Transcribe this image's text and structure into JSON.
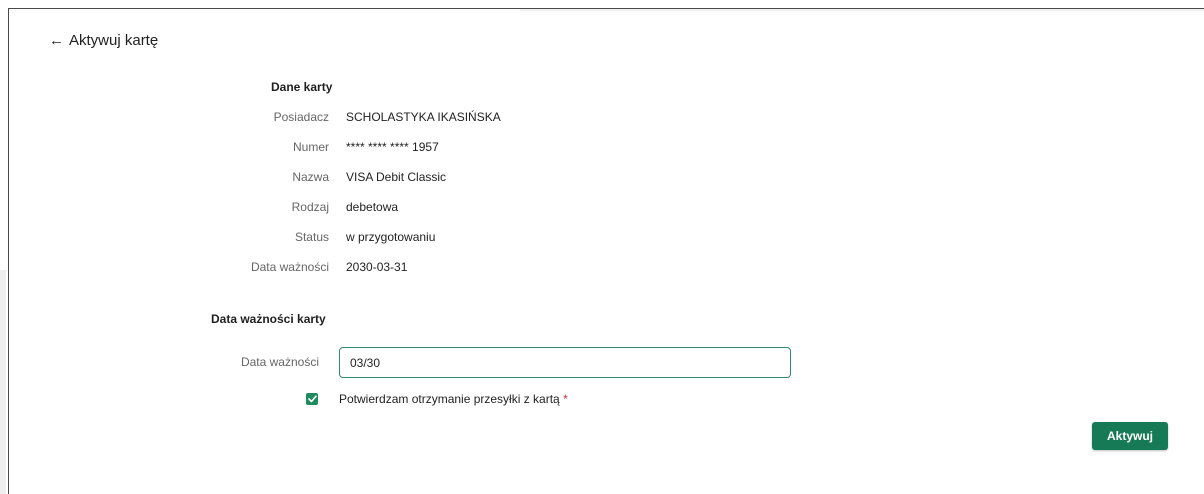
{
  "header": {
    "back_arrow": "←",
    "title": "Aktywuj kartę"
  },
  "card_details": {
    "section_title": "Dane karty",
    "rows": [
      {
        "label": "Posiadacz",
        "value": "SCHOLASTYKA IKASIŃSKA"
      },
      {
        "label": "Numer",
        "value": "**** **** **** 1957"
      },
      {
        "label": "Nazwa",
        "value": "VISA Debit Classic"
      },
      {
        "label": "Rodzaj",
        "value": "debetowa"
      },
      {
        "label": "Status",
        "value": "w przygotowaniu"
      },
      {
        "label": "Data ważności",
        "value": "2030-03-31"
      }
    ]
  },
  "expiry_form": {
    "section_title": "Data ważności karty",
    "field_label": "Data ważności",
    "field_value": "03/30",
    "checkbox_checked": true,
    "checkbox_label": "Potwierdzam otrzymanie przesyłki z kartą",
    "required_marker": "*"
  },
  "actions": {
    "submit_label": "Aktywuj"
  },
  "colors": {
    "accent": "#177a56",
    "input_border": "#2e8a6b",
    "required": "#d32f2f"
  }
}
